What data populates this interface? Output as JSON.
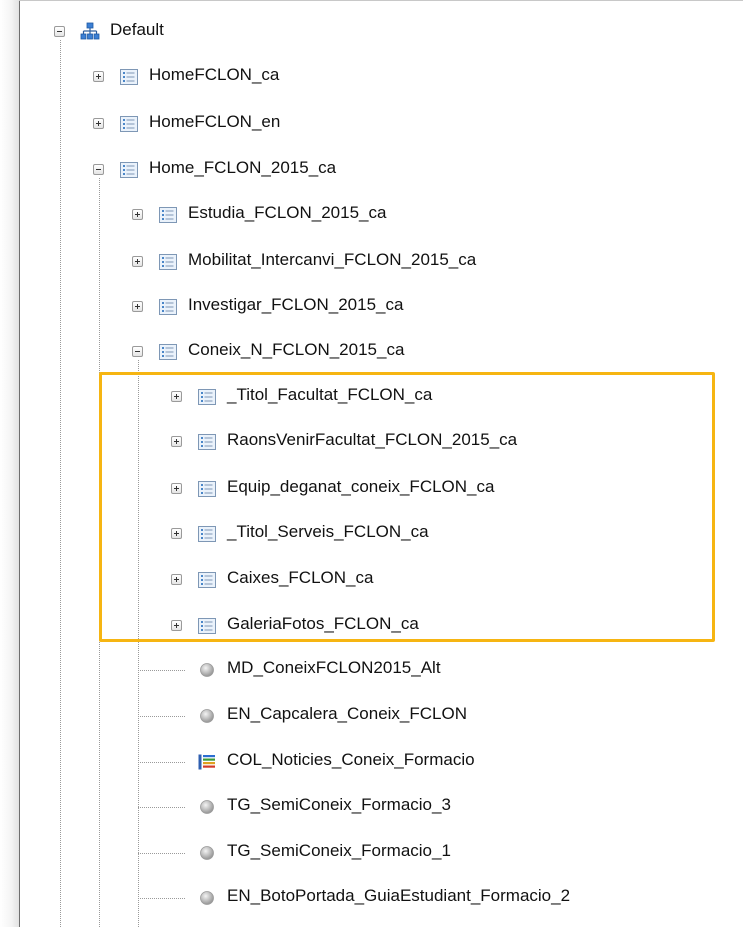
{
  "highlight_color": "#f6b512",
  "tree": [
    {
      "label": "Default",
      "icon": "network-icon",
      "toggle": "collapse"
    },
    {
      "label": "HomeFCLON_ca",
      "icon": "page-list-icon",
      "toggle": "expand"
    },
    {
      "label": "HomeFCLON_en",
      "icon": "page-list-icon",
      "toggle": "expand"
    },
    {
      "label": "Home_FCLON_2015_ca",
      "icon": "page-list-icon",
      "toggle": "collapse"
    },
    {
      "label": "Estudia_FCLON_2015_ca",
      "icon": "page-list-icon",
      "toggle": "expand"
    },
    {
      "label": "Mobilitat_Intercanvi_FCLON_2015_ca",
      "icon": "page-list-icon",
      "toggle": "expand"
    },
    {
      "label": "Investigar_FCLON_2015_ca",
      "icon": "page-list-icon",
      "toggle": "expand"
    },
    {
      "label": "Coneix_N_FCLON_2015_ca",
      "icon": "page-list-icon",
      "toggle": "collapse"
    },
    {
      "label": "_Titol_Facultat_FCLON_ca",
      "icon": "page-list-icon",
      "toggle": "expand"
    },
    {
      "label": "RaonsVenirFacultat_FCLON_2015_ca",
      "icon": "page-list-icon",
      "toggle": "expand"
    },
    {
      "label": "Equip_deganat_coneix_FCLON_ca",
      "icon": "page-list-icon",
      "toggle": "expand"
    },
    {
      "label": "_Titol_Serveis_FCLON_ca",
      "icon": "page-list-icon",
      "toggle": "expand"
    },
    {
      "label": "Caixes_FCLON_ca",
      "icon": "page-list-icon",
      "toggle": "expand"
    },
    {
      "label": "GaleriaFotos_FCLON_ca",
      "icon": "page-list-icon",
      "toggle": "expand"
    },
    {
      "label": "MD_ConeixFCLON2015_Alt",
      "icon": "gray-circle-icon",
      "toggle": "none"
    },
    {
      "label": "EN_Capcalera_Coneix_FCLON",
      "icon": "gray-circle-icon",
      "toggle": "none"
    },
    {
      "label": "COL_Noticies_Coneix_Formacio",
      "icon": "color-list-icon",
      "toggle": "none"
    },
    {
      "label": "TG_SemiConeix_Formacio_3",
      "icon": "gray-circle-icon",
      "toggle": "none"
    },
    {
      "label": "TG_SemiConeix_Formacio_1",
      "icon": "gray-circle-icon",
      "toggle": "none"
    },
    {
      "label": "EN_BotoPortada_GuiaEstudiant_Formacio_2",
      "icon": "gray-circle-icon",
      "toggle": "none"
    }
  ]
}
